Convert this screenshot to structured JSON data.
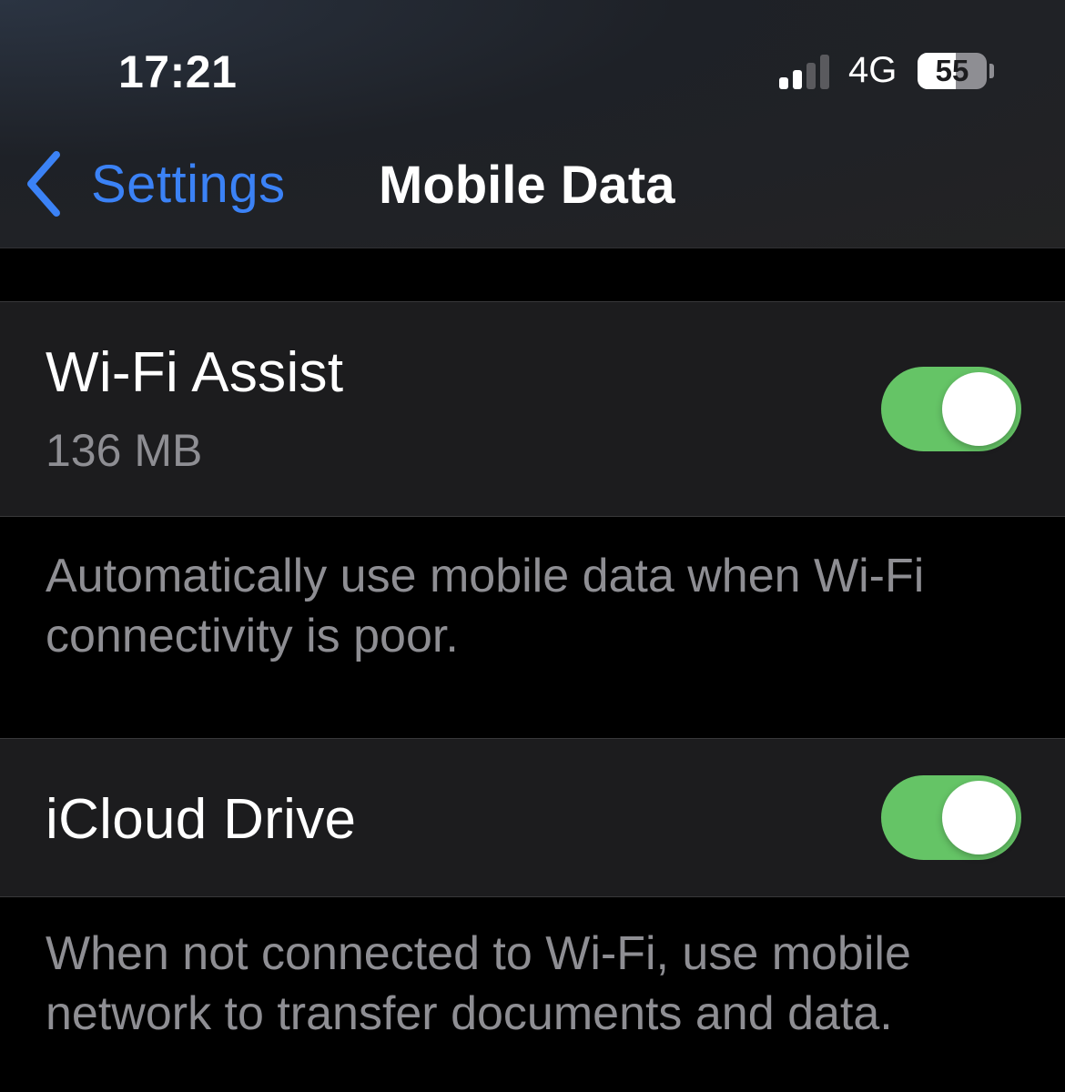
{
  "status_bar": {
    "time": "17:21",
    "network": "4G",
    "battery": "55",
    "battery_level_percent": 55,
    "signal_bars_active": 2,
    "signal_bars_total": 4
  },
  "nav": {
    "back_label": "Settings",
    "title": "Mobile Data"
  },
  "colors": {
    "accent": "#3b82f6",
    "toggle_on": "#65c466",
    "row_bg": "#1c1c1e",
    "secondary_text": "#8e8e93"
  },
  "wifi_assist": {
    "label": "Wi-Fi Assist",
    "usage": "136 MB",
    "enabled": true,
    "footer": "Automatically use mobile data when Wi-Fi connectivity is poor."
  },
  "icloud_drive": {
    "label": "iCloud Drive",
    "enabled": true,
    "footer": "When not connected to Wi-Fi, use mobile network to transfer documents and data."
  }
}
